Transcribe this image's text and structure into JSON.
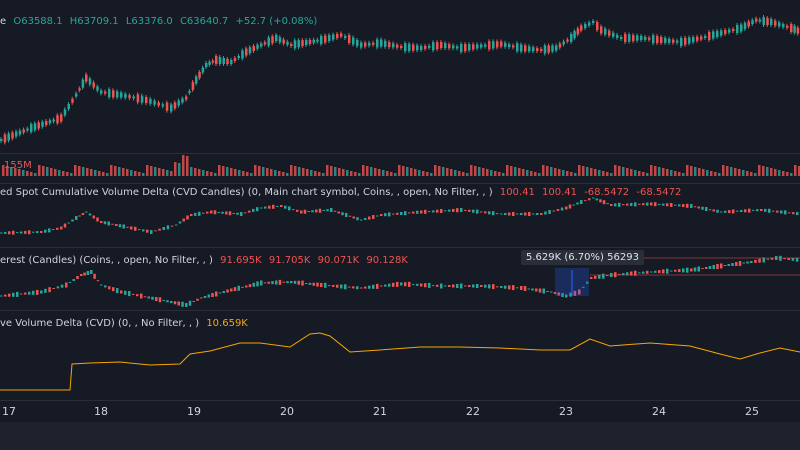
{
  "main_legend": {
    "prefix": "e",
    "open": "O63588.1",
    "high": "H63709.1",
    "low": "L63376.0",
    "close": "C63640.7",
    "change": "+52.7 (+0.08%)"
  },
  "volume_legend": {
    "value": "155M"
  },
  "cvd_spot_legend": {
    "title": "ed Spot Cumulative Volume Delta (CVD Candles) (0, Main chart symbol, Coins, , open, No Filter, , )",
    "v1": "100.41",
    "v2": "100.41",
    "v3": "-68.5472",
    "v4": "-68.5472"
  },
  "oi_legend": {
    "title": "erest (Candles) (Coins, , open, No Filter, , )",
    "v1": "91.695K",
    "v2": "91.705K",
    "v3": "90.071K",
    "v4": "90.128K"
  },
  "cvd_legend": {
    "title": "ve Volume Delta (CVD) (0, , No Filter, , )",
    "value": "10.659K"
  },
  "measure_tooltip": {
    "text": "5.629K (6.70%) 56293"
  },
  "x_axis": {
    "labels": [
      "17",
      "18",
      "19",
      "20",
      "21",
      "22",
      "23",
      "24",
      "25"
    ]
  },
  "colors": {
    "up": "#26a69a",
    "down": "#ef5350",
    "line": "#f7a600",
    "background": "#161a25"
  }
}
